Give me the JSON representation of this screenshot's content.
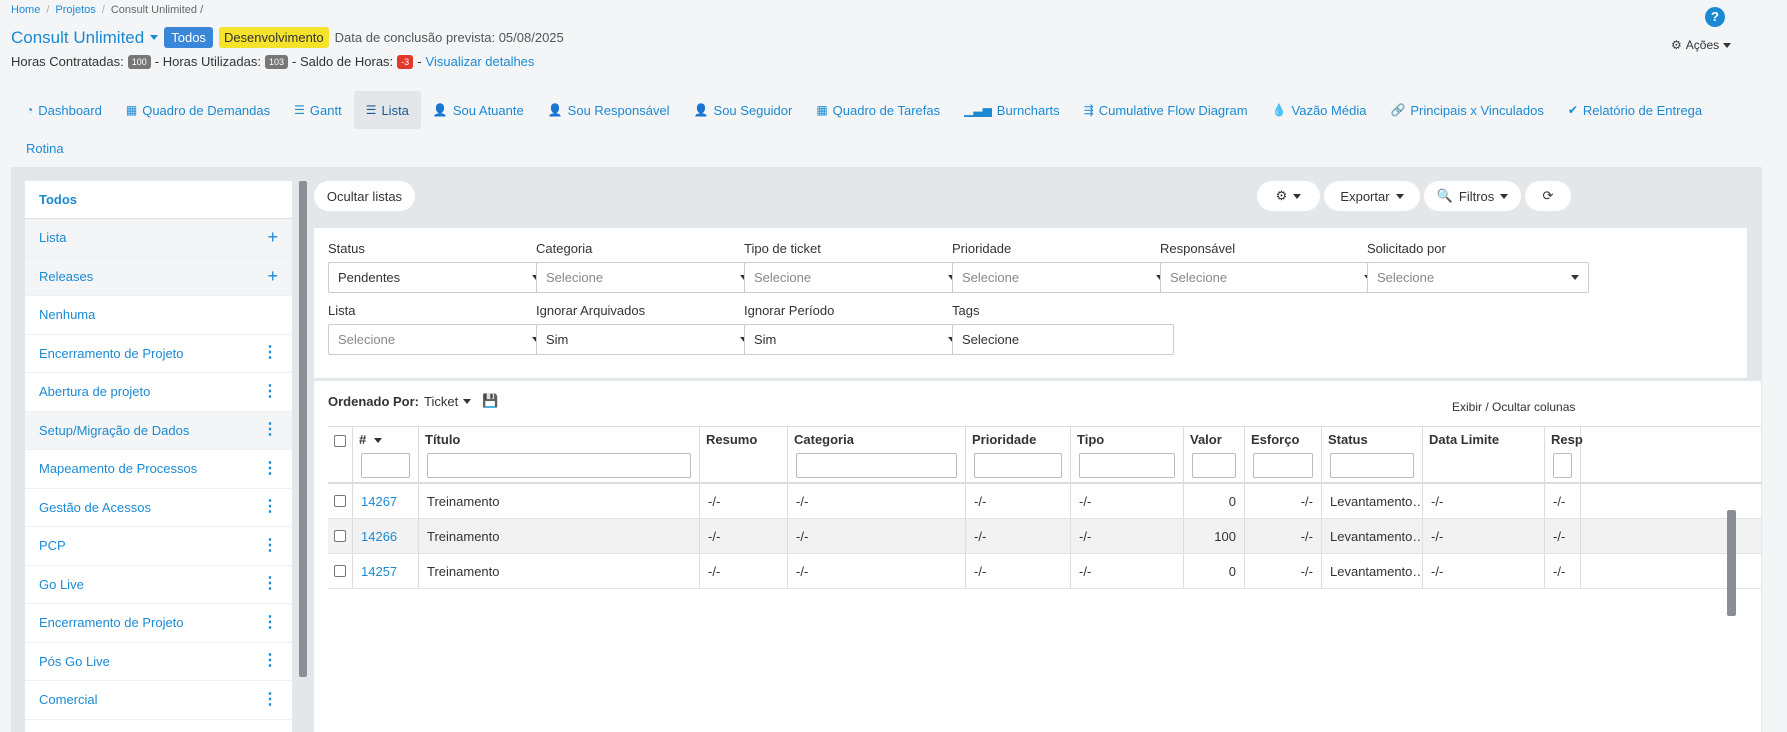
{
  "breadcrumb": [
    "Home",
    "Projetos",
    "Consult Unlimited /"
  ],
  "project": {
    "title": "Consult Unlimited",
    "badge_todos": "Todos",
    "badge_status": "Desenvolvimento",
    "deadline": "Data de conclusão prevista: 05/08/2025"
  },
  "hours": {
    "contracted_label": "Horas Contratadas:",
    "contracted": "100",
    "used_label": "- Horas Utilizadas:",
    "used": "103",
    "balance_label": "- Saldo de Horas:",
    "balance": "-3",
    "details_sep": "-",
    "details_link": "Visualizar detalhes"
  },
  "help_label": "?",
  "actions_label": "Ações",
  "nav": [
    {
      "label": "Dashboard",
      "icon": "dashboard-icon",
      "glyph": "◔"
    },
    {
      "label": "Quadro de Demandas",
      "icon": "grid-icon",
      "glyph": "▦"
    },
    {
      "label": "Gantt",
      "icon": "gantt-icon",
      "glyph": "☰"
    },
    {
      "label": "Lista",
      "icon": "list-icon",
      "glyph": "☰",
      "active": true
    },
    {
      "label": "Sou Atuante",
      "icon": "user-icon",
      "glyph": "👤"
    },
    {
      "label": "Sou Responsável",
      "icon": "user-icon",
      "glyph": "👤"
    },
    {
      "label": "Sou Seguidor",
      "icon": "user-icon",
      "glyph": "👤"
    },
    {
      "label": "Quadro de Tarefas",
      "icon": "table-icon",
      "glyph": "▦"
    },
    {
      "label": "Burncharts",
      "icon": "signal-icon",
      "glyph": "▁▃▅"
    },
    {
      "label": "Cumulative Flow Diagram",
      "icon": "flow-icon",
      "glyph": "⇶"
    },
    {
      "label": "Vazão Média",
      "icon": "drop-icon",
      "glyph": "💧"
    },
    {
      "label": "Principais x Vinculados",
      "icon": "link-icon",
      "glyph": "🔗"
    },
    {
      "label": "Relatório de Entrega",
      "icon": "check-circle-icon",
      "glyph": "✔"
    },
    {
      "label": "Rotina",
      "icon": "",
      "glyph": ""
    }
  ],
  "sidebar": {
    "items": [
      {
        "label": "Todos",
        "bold": true
      },
      {
        "label": "Lista",
        "action": "plus",
        "grey": true
      },
      {
        "label": "Releases",
        "action": "plus",
        "grey": true
      },
      {
        "label": "Nenhuma"
      },
      {
        "label": "Encerramento de Projeto",
        "action": "dots"
      },
      {
        "label": "Abertura de projeto",
        "action": "dots"
      },
      {
        "label": "Setup/Migração de Dados",
        "action": "dots",
        "grey": true
      },
      {
        "label": "Mapeamento de Processos",
        "action": "dots"
      },
      {
        "label": "Gestão de Acessos",
        "action": "dots"
      },
      {
        "label": "PCP",
        "action": "dots"
      },
      {
        "label": "Go Live",
        "action": "dots"
      },
      {
        "label": "Encerramento de Projeto",
        "action": "dots"
      },
      {
        "label": "Pós Go Live",
        "action": "dots"
      },
      {
        "label": "Comercial",
        "action": "dots"
      }
    ]
  },
  "toolbar": {
    "hide_lists": "Ocultar listas",
    "export": "Exportar",
    "filters": "Filtros"
  },
  "filters": [
    {
      "label": "Status",
      "value": "Pendentes",
      "placeholder": false
    },
    {
      "label": "Categoria",
      "value": "Selecione",
      "placeholder": true
    },
    {
      "label": "Tipo de ticket",
      "value": "Selecione",
      "placeholder": true
    },
    {
      "label": "Prioridade",
      "value": "Selecione",
      "placeholder": true
    },
    {
      "label": "Responsável",
      "value": "Selecione",
      "placeholder": true
    },
    {
      "label": "Solicitado por",
      "value": "Selecione",
      "placeholder": true
    },
    {
      "label": "Lista",
      "value": "Selecione",
      "placeholder": true
    },
    {
      "label": "Ignorar Arquivados",
      "value": "Sim",
      "placeholder": false
    },
    {
      "label": "Ignorar Período",
      "value": "Sim",
      "placeholder": false
    },
    {
      "label": "Tags",
      "value": "Selecione",
      "placeholder": false,
      "text": true
    }
  ],
  "ordering": {
    "label": "Ordenado Por:",
    "value": "Ticket"
  },
  "toggle_columns": "Exibir / Ocultar colunas",
  "table": {
    "columns": [
      "#",
      "Título",
      "Resumo",
      "Categoria",
      "Prioridade",
      "Tipo",
      "Valor",
      "Esforço",
      "Status",
      "Data Limite",
      "Resp"
    ],
    "rows": [
      {
        "id": "14267",
        "title": "Treinamento",
        "resumo": "-/-",
        "categoria": "-/-",
        "prioridade": "-/-",
        "tipo": "-/-",
        "valor": "0",
        "esforco": "-/-",
        "status": "Levantamento…",
        "data": "-/-",
        "resp": "-/-"
      },
      {
        "id": "14266",
        "title": "Treinamento",
        "resumo": "-/-",
        "categoria": "-/-",
        "prioridade": "-/-",
        "tipo": "-/-",
        "valor": "100",
        "esforco": "-/-",
        "status": "Levantamento…",
        "data": "-/-",
        "resp": "-/-"
      },
      {
        "id": "14257",
        "title": "Treinamento",
        "resumo": "-/-",
        "categoria": "-/-",
        "prioridade": "-/-",
        "tipo": "-/-",
        "valor": "0",
        "esforco": "-/-",
        "status": "Levantamento…",
        "data": "-/-",
        "resp": "-/-"
      }
    ]
  }
}
